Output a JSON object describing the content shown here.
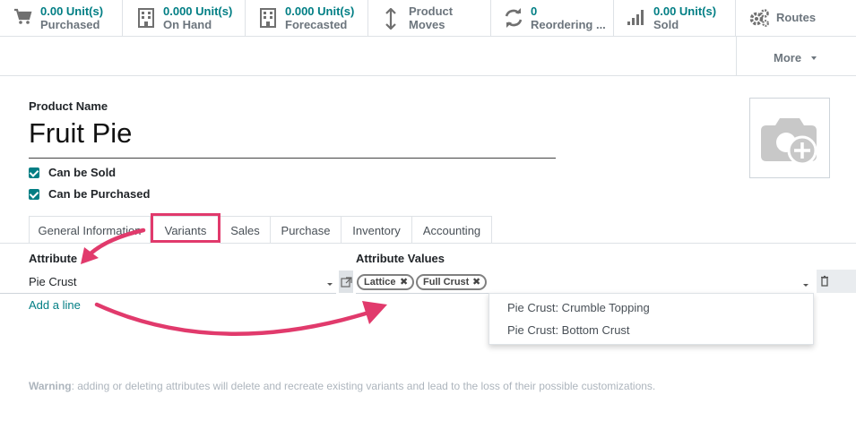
{
  "statbar": {
    "purchased": {
      "value": "0.00 Unit(s)",
      "label": "Purchased"
    },
    "on_hand": {
      "value": "0.000 Unit(s)",
      "label": "On Hand"
    },
    "forecasted": {
      "value": "0.000 Unit(s)",
      "label": "Forecasted"
    },
    "moves": {
      "value": "Product",
      "label": "Moves"
    },
    "reordering": {
      "value": "0",
      "label": "Reordering ..."
    },
    "sold": {
      "value": "0.00 Unit(s)",
      "label": "Sold"
    },
    "routes": {
      "label": "Routes"
    },
    "more": {
      "label": "More"
    }
  },
  "form": {
    "product_name_label": "Product Name",
    "product_name": "Fruit Pie",
    "can_be_sold": "Can be Sold",
    "can_be_purchased": "Can be Purchased"
  },
  "tabs": [
    "General Information",
    "Variants",
    "Sales",
    "Purchase",
    "Inventory",
    "Accounting"
  ],
  "active_tab": "Variants",
  "attributes": {
    "col_attribute": "Attribute",
    "col_values": "Attribute Values",
    "row": {
      "attribute": "Pie Crust",
      "values": [
        "Lattice",
        "Full Crust"
      ]
    },
    "add_line": "Add a line",
    "dropdown_options": [
      "Pie Crust: Crumble Topping",
      "Pie Crust: Bottom Crust"
    ]
  },
  "warning": {
    "bold": "Warning",
    "text": ": adding or deleting attributes will delete and recreate existing variants and lead to the loss of their possible customizations."
  },
  "colors": {
    "accent": "#017e84",
    "annotation": "#e13a6c",
    "text_muted": "#6c757d"
  },
  "icons": [
    "cart-icon",
    "building-icon",
    "building-icon",
    "arrows-vertical-icon",
    "refresh-icon",
    "signal-bars-icon",
    "gears-icon",
    "camera-plus-icon",
    "external-link-icon",
    "trash-icon"
  ]
}
